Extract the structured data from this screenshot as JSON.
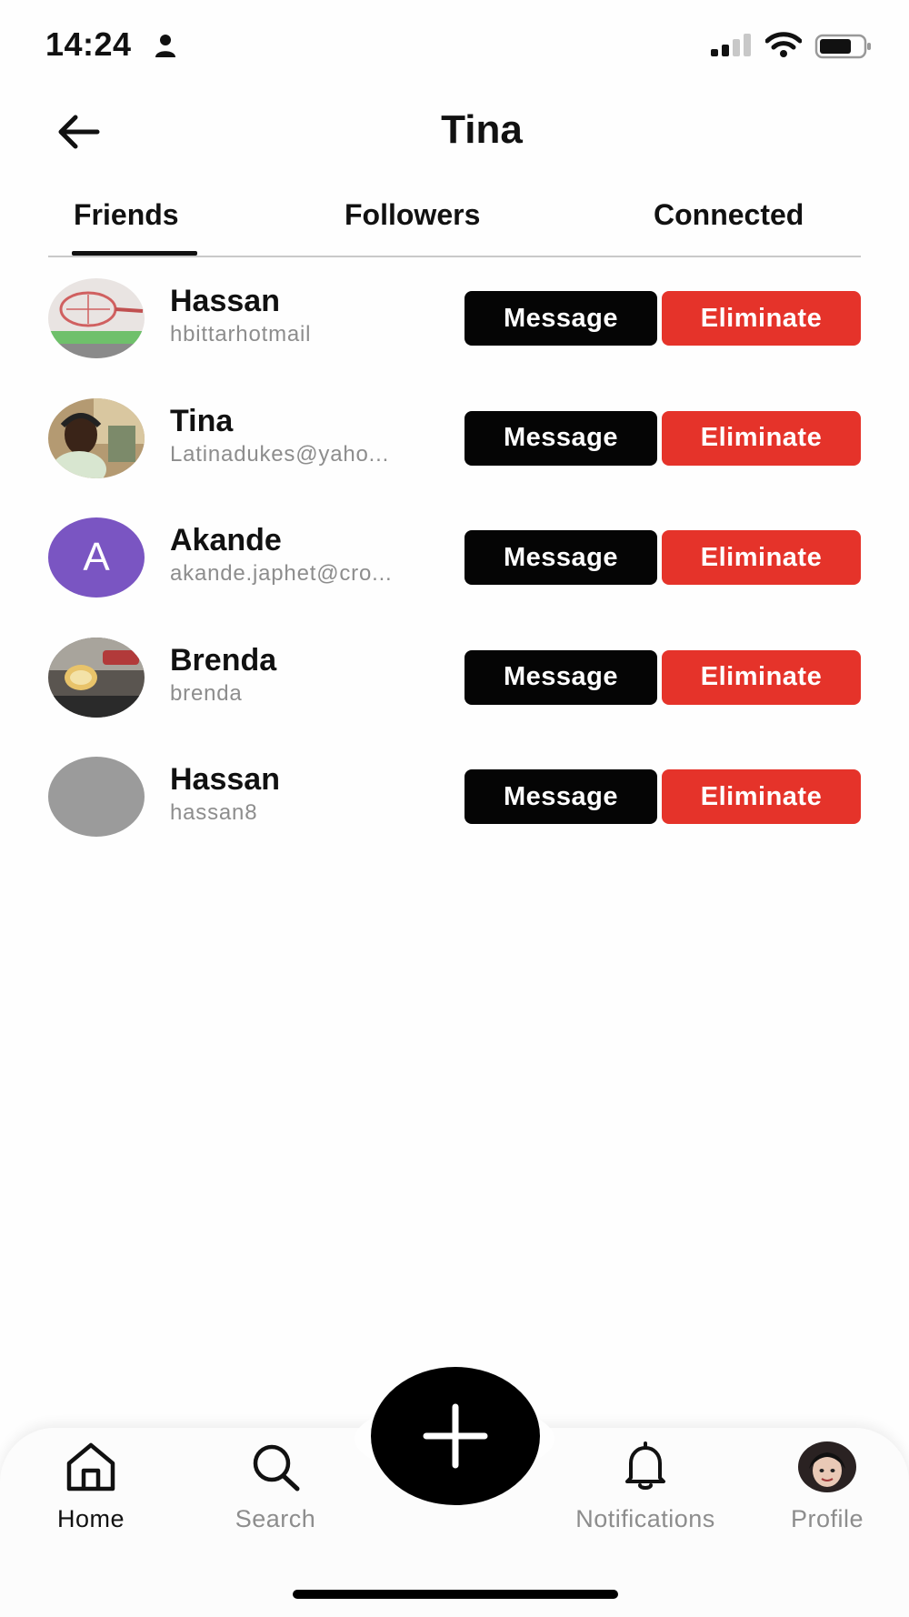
{
  "status_bar": {
    "time": "14:24",
    "icons": [
      "person-icon",
      "signal-icon",
      "wifi-icon",
      "battery-icon"
    ]
  },
  "header": {
    "back_icon": "arrow-left-icon",
    "title": "Tina"
  },
  "tabs": [
    {
      "label": "Friends",
      "active": true
    },
    {
      "label": "Followers",
      "active": false
    },
    {
      "label": "Connected",
      "active": false
    }
  ],
  "friends": [
    {
      "name": "Hassan",
      "handle": "hbittarhotmail",
      "avatar": "photo-racket"
    },
    {
      "name": "Tina",
      "handle": "Latinadukes@yaho...",
      "avatar": "photo-woman"
    },
    {
      "name": "Akande",
      "handle": "akande.japhet@cro...",
      "avatar": "letter",
      "avatar_letter": "A",
      "avatar_color": "#7a55c2"
    },
    {
      "name": "Brenda",
      "handle": "brenda",
      "avatar": "photo-car"
    },
    {
      "name": "Hassan",
      "handle": "hassan8",
      "avatar": "placeholder-gray"
    }
  ],
  "actions": {
    "message_label": "Message",
    "eliminate_label": "Eliminate",
    "message_color": "#050505",
    "eliminate_color": "#e5332a"
  },
  "bottom_nav": {
    "items": [
      {
        "label": "Home",
        "icon": "home-icon",
        "active": true
      },
      {
        "label": "Search",
        "icon": "search-icon",
        "active": false
      },
      {
        "label": "Notifications",
        "icon": "bell-icon",
        "active": false
      },
      {
        "label": "Profile",
        "icon": "profile-avatar",
        "active": false
      }
    ],
    "fab_icon": "plus-icon"
  }
}
